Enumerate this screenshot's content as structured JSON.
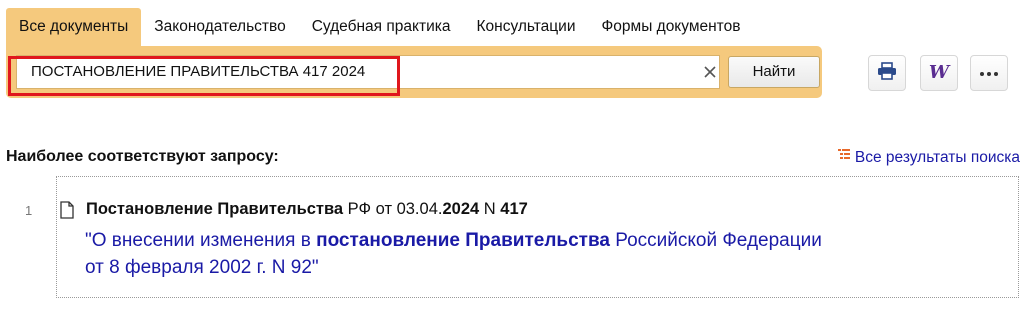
{
  "tabs": [
    {
      "label": "Все документы",
      "active": true
    },
    {
      "label": "Законодательство",
      "active": false
    },
    {
      "label": "Судебная практика",
      "active": false
    },
    {
      "label": "Консультации",
      "active": false
    },
    {
      "label": "Формы документов",
      "active": false
    }
  ],
  "search": {
    "query": "ПОСТАНОВЛЕНИЕ ПРАВИТЕЛЬСТВА 417 2024",
    "find_label": "Найти",
    "clear_icon": "close-icon"
  },
  "toolbar": {
    "print_icon": "printer-icon",
    "word_icon": "word-export-icon",
    "word_glyph": "W",
    "more_icon": "more-horizontal-icon"
  },
  "results": {
    "heading": "Наиболее соответствуют запросу:",
    "all_results_label": "Все результаты поиска",
    "items": [
      {
        "number": "1",
        "title_parts": {
          "p1": "Постановление Правительства",
          "p2": " РФ от 03.04.",
          "p3": "2024",
          "p4": " N ",
          "p5": "417"
        },
        "link_parts": {
          "l1": "\"О внесении изменения в ",
          "l2": "постановление Правительства",
          "l3": " Российской Федерации",
          "l4": "от 8 февраля 2002 г. N 92\""
        }
      }
    ]
  },
  "colors": {
    "accent": "#f5c97d",
    "link": "#1a1aa6",
    "highlight": "#e0171d",
    "word": "#5a2d91"
  }
}
